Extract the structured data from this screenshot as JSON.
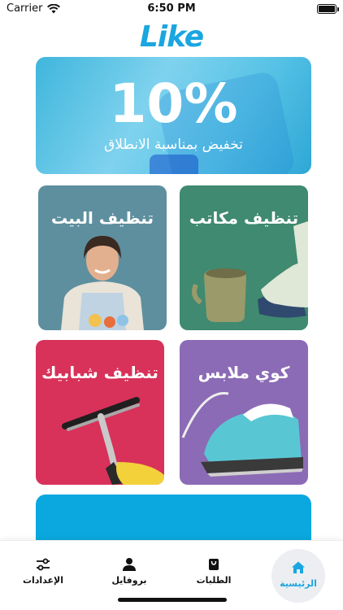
{
  "status_bar": {
    "carrier": "Carrier",
    "time": "6:50 PM"
  },
  "logo": "Like",
  "promo": {
    "percent": "10%",
    "caption": "تخفيض بمناسبة الانطلاق"
  },
  "services": [
    {
      "title": "تنظيف مكاتب"
    },
    {
      "title": "تنظيف البيت"
    },
    {
      "title": "كوي ملابس"
    },
    {
      "title": "تنظيف شبابيك"
    }
  ],
  "tab_bar": {
    "home": "الرئيسية",
    "orders": "الطلبات",
    "profile": "بروفايل",
    "settings": "الإعدادات"
  },
  "colors": {
    "accent": "#1aa6e0",
    "office": "#3f8a70",
    "home": "#5e8f9e",
    "iron": "#8b6bb5",
    "windows": "#d8325a"
  }
}
